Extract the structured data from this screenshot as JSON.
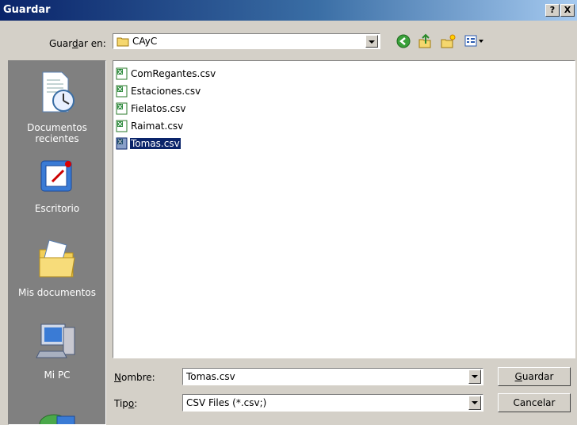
{
  "window": {
    "title": "Guardar",
    "help_label": "?",
    "close_label": "X"
  },
  "toolbar": {
    "save_in_label": "Guardar en:",
    "save_in_value": "CAyC",
    "icons": [
      "back-icon",
      "up-folder-icon",
      "new-folder-icon",
      "view-menu-icon"
    ]
  },
  "places": [
    {
      "label": "Documentos recientes",
      "icon": "recent-documents-icon"
    },
    {
      "label": "Escritorio",
      "icon": "desktop-icon"
    },
    {
      "label": "Mis documentos",
      "icon": "my-documents-icon"
    },
    {
      "label": "Mi PC",
      "icon": "my-computer-icon"
    }
  ],
  "files": [
    {
      "name": "ComRegantes.csv",
      "selected": false
    },
    {
      "name": "Estaciones.csv",
      "selected": false
    },
    {
      "name": "Fielatos.csv",
      "selected": false
    },
    {
      "name": "Raimat.csv",
      "selected": false
    },
    {
      "name": "Tomas.csv",
      "selected": true
    }
  ],
  "form": {
    "name_label": "Nombre:",
    "name_value": "Tomas.csv",
    "type_label": "Tipo:",
    "type_value": "CSV Files (*.csv;)"
  },
  "buttons": {
    "save": "Guardar",
    "cancel": "Cancelar"
  }
}
